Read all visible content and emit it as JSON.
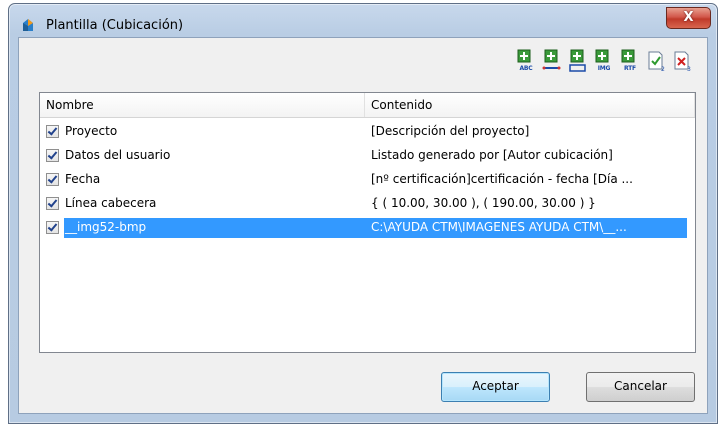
{
  "window": {
    "title": "Plantilla (Cubicación)",
    "close_glyph": "X"
  },
  "toolbar": {
    "buttons": [
      {
        "name": "add-text-button",
        "label": "ABC",
        "icon": "add-text-icon"
      },
      {
        "name": "add-line-button",
        "label": "",
        "icon": "add-line-icon"
      },
      {
        "name": "add-box-button",
        "label": "",
        "icon": "add-box-icon"
      },
      {
        "name": "add-image-button",
        "label": "IMG",
        "icon": "add-image-icon"
      },
      {
        "name": "add-rtf-button",
        "label": "RTF",
        "icon": "add-rtf-icon"
      },
      {
        "name": "edit-item-button",
        "label": "",
        "icon": "edit-document-icon"
      },
      {
        "name": "delete-item-button",
        "label": "",
        "icon": "delete-document-icon"
      }
    ]
  },
  "list": {
    "columns": [
      "Nombre",
      "Contenido"
    ],
    "rows": [
      {
        "name": "Proyecto",
        "content": "[Descripción del proyecto]",
        "checked": true,
        "selected": false
      },
      {
        "name": "Datos del usuario",
        "content": "Listado generado por [Autor cubicación]",
        "checked": true,
        "selected": false
      },
      {
        "name": "Fecha",
        "content": " [nº certificación]certificación - fecha [Día ...",
        "checked": true,
        "selected": false
      },
      {
        "name": "Línea cabecera",
        "content": "{ ( 10.00, 30.00 ), ( 190.00, 30.00 ) }",
        "checked": true,
        "selected": false
      },
      {
        "name": "__img52-bmp",
        "content": "C:\\AYUDA CTM\\IMAGENES AYUDA CTM\\__...",
        "checked": true,
        "selected": true
      }
    ]
  },
  "buttons": {
    "accept": "Aceptar",
    "cancel": "Cancelar"
  },
  "colors": {
    "selection": "#3399ff",
    "icon_green": "#2e8b2e"
  }
}
